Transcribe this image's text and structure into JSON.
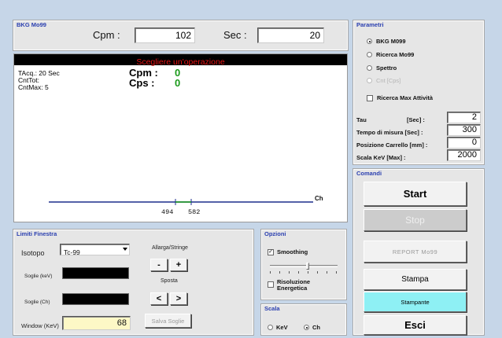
{
  "bkg": {
    "title": "BKG Mo99",
    "cpm_label": "Cpm :",
    "cpm_value": "102",
    "sec_label": "Sec :",
    "sec_value": "20"
  },
  "display": {
    "banner": "Scegliere un'operazione",
    "tacq": "TAcq.: 20 Sec",
    "cnttot": "CntTot:",
    "cntmax": "CntMax: 5",
    "cpm_label": "Cpm :",
    "cpm_value": "0",
    "cps_label": "Cps :",
    "cps_value": "0",
    "axis_label": "Ch",
    "marker1": "494",
    "marker2": "582",
    "axis_color": "#1c2e8c",
    "marker_color": "#1a9a1a"
  },
  "limiti": {
    "title": "Limiti Finestra",
    "isotopo_label": "Isotopo",
    "isotopo_value": "Tc-99",
    "soglie_kev_label": "Soglie (keV)",
    "soglie_ch_label": "Soglie (Ch)",
    "window_label": "Window (KeV)",
    "window_value": "68",
    "allarga_label": "Allarga/Stringe",
    "minus": "-",
    "plus": "+",
    "sposta_label": "Sposta",
    "left": "<",
    "right": ">",
    "salva": "Salva Soglie"
  },
  "opzioni": {
    "title": "Opzioni",
    "smoothing": "Smoothing",
    "smoothing_checked": true,
    "risoluzione": "Risoluzione Energetica",
    "risoluzione_checked": false
  },
  "scala": {
    "title": "Scala",
    "kev": "KeV",
    "ch": "Ch",
    "selected": "Ch"
  },
  "parametri": {
    "title": "Parametri",
    "modes": [
      {
        "label": "BKG M099",
        "selected": true,
        "enabled": true
      },
      {
        "label": "Ricerca Mo99",
        "selected": false,
        "enabled": true
      },
      {
        "label": "Spettro",
        "selected": false,
        "enabled": true
      },
      {
        "label": "Cnt [Cps]",
        "selected": false,
        "enabled": false
      }
    ],
    "ricerca_max": "Ricerca Max Attività",
    "fields": [
      {
        "label": "Tau",
        "unit": "[Sec] :",
        "value": "2"
      },
      {
        "label": "Tempo di misura [Sec] :",
        "unit": "",
        "value": "300"
      },
      {
        "label": "Posizione Carrello [mm] :",
        "unit": "",
        "value": "0"
      },
      {
        "label": "Scala  KeV [Max] :",
        "unit": "",
        "value": "2000"
      }
    ]
  },
  "comandi": {
    "title": "Comandi",
    "start": "Start",
    "stop": "Stop",
    "report": "REPORT  Mo99",
    "stampa": "Stampa",
    "stampante": "Stampante",
    "esci": "Esci",
    "stampante_color": "#8ef0f4"
  }
}
